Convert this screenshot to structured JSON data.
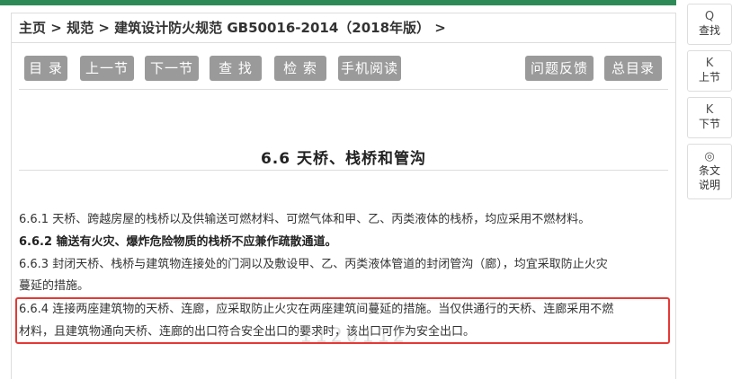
{
  "breadcrumb": {
    "home": "主页",
    "sep1": ">",
    "category": "规范",
    "sep2": ">",
    "doc": "建筑设计防火规范 GB50016-2014（2018年版）",
    "sep3": ">"
  },
  "toolbar": {
    "toc": "目 录",
    "prev": "上一节",
    "next": "下一节",
    "find": "查 找",
    "search": "检 索",
    "mobile": "手机阅读",
    "feedback": "问题反馈",
    "master_toc": "总目录"
  },
  "section": {
    "title": "6.6  天桥、栈桥和管沟"
  },
  "paragraphs": {
    "p1": "6.6.1 天桥、跨越房屋的栈桥以及供输送可燃材料、可燃气体和甲、乙、丙类液体的栈桥，均应采用不燃材料。",
    "p2": "6.6.2 输送有火灾、爆炸危险物质的栈桥不应兼作疏散通道。",
    "p3a": "6.6.3 封闭天桥、栈桥与建筑物连接处的门洞以及敷设甲、乙、丙类液体管道的封闭管沟（廊），均宜采取防止火灾",
    "p3b": "蔓延的措施。",
    "p4a": "6.6.4 连接两座建筑物的天桥、连廊，应采取防止火灾在两座建筑间蔓延的措施。当仅供通行的天桥、连廊采用不燃",
    "p4b": "材料，且建筑物通向天桥、连廊的出口符合安全出口的要求时，该出口可作为安全出口。"
  },
  "watermark": "1120112",
  "sidebar": {
    "find": {
      "icon": "Q",
      "label": "查找"
    },
    "up": {
      "icon": "K",
      "label": "上节"
    },
    "down": {
      "icon": "K",
      "label": "下节"
    },
    "notes": {
      "icon": "◎",
      "label1": "条文",
      "label2": "说明"
    }
  },
  "colors": {
    "accent_bar": "#2e8b57",
    "button": "#9a9a9a",
    "highlight": "#e53935"
  }
}
